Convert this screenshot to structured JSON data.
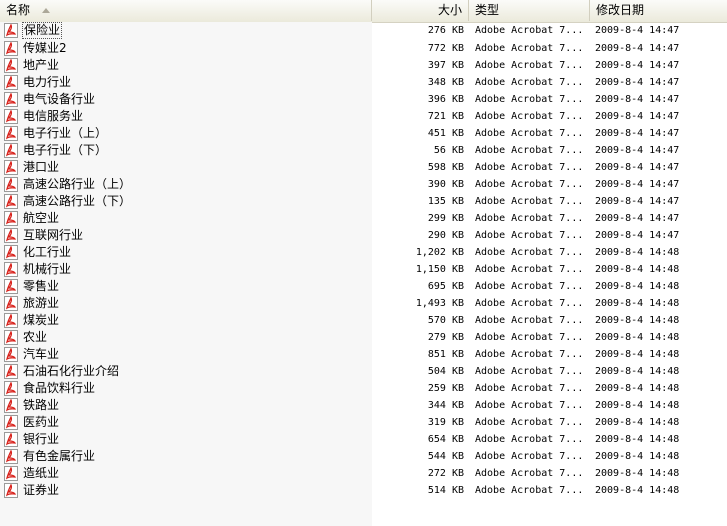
{
  "columns": {
    "name": "名称",
    "size": "大小",
    "type": "类型",
    "modified": "修改日期"
  },
  "files": [
    {
      "name": "保险业",
      "size": "276 KB",
      "type": "Adobe Acrobat 7...",
      "date": "2009-8-4 14:47"
    },
    {
      "name": "传媒业2",
      "size": "772 KB",
      "type": "Adobe Acrobat 7...",
      "date": "2009-8-4 14:47"
    },
    {
      "name": "地产业",
      "size": "397 KB",
      "type": "Adobe Acrobat 7...",
      "date": "2009-8-4 14:47"
    },
    {
      "name": "电力行业",
      "size": "348 KB",
      "type": "Adobe Acrobat 7...",
      "date": "2009-8-4 14:47"
    },
    {
      "name": "电气设备行业",
      "size": "396 KB",
      "type": "Adobe Acrobat 7...",
      "date": "2009-8-4 14:47"
    },
    {
      "name": "电信服务业",
      "size": "721 KB",
      "type": "Adobe Acrobat 7...",
      "date": "2009-8-4 14:47"
    },
    {
      "name": "电子行业（上）",
      "size": "451 KB",
      "type": "Adobe Acrobat 7...",
      "date": "2009-8-4 14:47"
    },
    {
      "name": "电子行业（下）",
      "size": "56 KB",
      "type": "Adobe Acrobat 7...",
      "date": "2009-8-4 14:47"
    },
    {
      "name": "港口业",
      "size": "598 KB",
      "type": "Adobe Acrobat 7...",
      "date": "2009-8-4 14:47"
    },
    {
      "name": "高速公路行业（上）",
      "size": "390 KB",
      "type": "Adobe Acrobat 7...",
      "date": "2009-8-4 14:47"
    },
    {
      "name": "高速公路行业（下）",
      "size": "135 KB",
      "type": "Adobe Acrobat 7...",
      "date": "2009-8-4 14:47"
    },
    {
      "name": "航空业",
      "size": "299 KB",
      "type": "Adobe Acrobat 7...",
      "date": "2009-8-4 14:47"
    },
    {
      "name": "互联网行业",
      "size": "290 KB",
      "type": "Adobe Acrobat 7...",
      "date": "2009-8-4 14:47"
    },
    {
      "name": "化工行业",
      "size": "1,202 KB",
      "type": "Adobe Acrobat 7...",
      "date": "2009-8-4 14:48"
    },
    {
      "name": "机械行业",
      "size": "1,150 KB",
      "type": "Adobe Acrobat 7...",
      "date": "2009-8-4 14:48"
    },
    {
      "name": "零售业",
      "size": "695 KB",
      "type": "Adobe Acrobat 7...",
      "date": "2009-8-4 14:48"
    },
    {
      "name": "旅游业",
      "size": "1,493 KB",
      "type": "Adobe Acrobat 7...",
      "date": "2009-8-4 14:48"
    },
    {
      "name": "煤炭业",
      "size": "570 KB",
      "type": "Adobe Acrobat 7...",
      "date": "2009-8-4 14:48"
    },
    {
      "name": "农业",
      "size": "279 KB",
      "type": "Adobe Acrobat 7...",
      "date": "2009-8-4 14:48"
    },
    {
      "name": "汽车业",
      "size": "851 KB",
      "type": "Adobe Acrobat 7...",
      "date": "2009-8-4 14:48"
    },
    {
      "name": "石油石化行业介绍",
      "size": "504 KB",
      "type": "Adobe Acrobat 7...",
      "date": "2009-8-4 14:48"
    },
    {
      "name": "食品饮料行业",
      "size": "259 KB",
      "type": "Adobe Acrobat 7...",
      "date": "2009-8-4 14:48"
    },
    {
      "name": "铁路业",
      "size": "344 KB",
      "type": "Adobe Acrobat 7...",
      "date": "2009-8-4 14:48"
    },
    {
      "name": "医药业",
      "size": "319 KB",
      "type": "Adobe Acrobat 7...",
      "date": "2009-8-4 14:48"
    },
    {
      "name": "银行业",
      "size": "654 KB",
      "type": "Adobe Acrobat 7...",
      "date": "2009-8-4 14:48"
    },
    {
      "name": "有色金属行业",
      "size": "544 KB",
      "type": "Adobe Acrobat 7...",
      "date": "2009-8-4 14:48"
    },
    {
      "name": "造纸业",
      "size": "272 KB",
      "type": "Adobe Acrobat 7...",
      "date": "2009-8-4 14:48"
    },
    {
      "name": "证券业",
      "size": "514 KB",
      "type": "Adobe Acrobat 7...",
      "date": "2009-8-4 14:48"
    }
  ],
  "icons": {
    "file": "pdf-file-icon",
    "sort": "sort-ascending-icon"
  },
  "colors": {
    "pdf_red": "#d8211b",
    "header_bg": "#ebeadb",
    "sorted_column_bg": "#f7f7f7"
  },
  "selected_index": 0
}
